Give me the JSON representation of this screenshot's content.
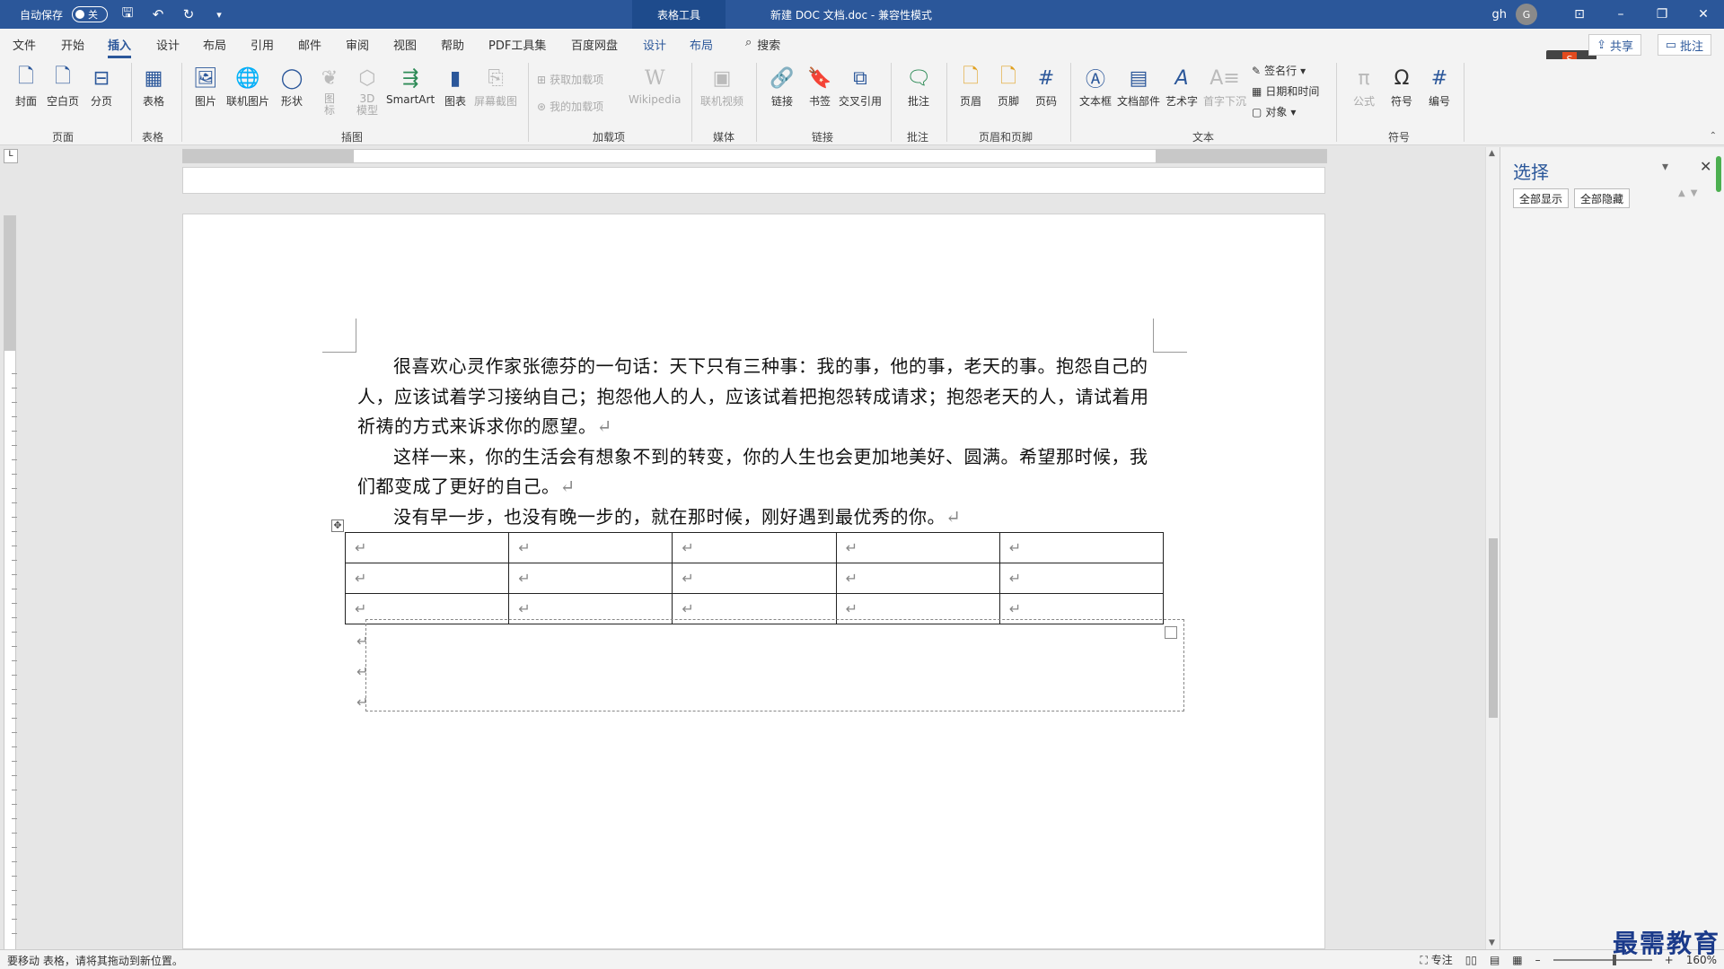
{
  "titlebar": {
    "autosave_label": "自动保存",
    "autosave_state": "关",
    "context_tab": "表格工具",
    "document_title": "新建 DOC 文档.doc  -  兼容性模式",
    "user": "gh",
    "avatar_initial": "G"
  },
  "tabs": {
    "file": "文件",
    "home": "开始",
    "insert": "插入",
    "design": "设计",
    "layout": "布局",
    "references": "引用",
    "mailings": "邮件",
    "review": "审阅",
    "view": "视图",
    "help": "帮助",
    "pdf": "PDF工具集",
    "baidu": "百度网盘",
    "table_design": "设计",
    "table_layout": "布局",
    "search": "搜索"
  },
  "header_actions": {
    "share": "共享",
    "comment": "批注"
  },
  "ribbon": {
    "cover": "封面",
    "blank_page": "空白页",
    "page_break": "分页",
    "table": "表格",
    "picture": "图片",
    "online_picture": "联机图片",
    "shapes": "形状",
    "icons": "图\n标",
    "model3d": "3D\n模型",
    "smartart": "SmartArt",
    "chart": "图表",
    "screenshot": "屏幕截图",
    "get_addins": "获取加载项",
    "my_addins": "我的加载项",
    "wikipedia": "Wikipedia",
    "online_video": "联机视频",
    "link": "链接",
    "bookmark": "书签",
    "cross_ref": "交叉引用",
    "comment": "批注",
    "header": "页眉",
    "footer": "页脚",
    "page_number": "页码",
    "textbox": "文本框",
    "quick_parts": "文档部件",
    "wordart": "艺术字",
    "dropcap": "首字下沉",
    "signature": "签名行",
    "datetime": "日期和时间",
    "object": "对象",
    "equation": "公式",
    "symbol": "符号",
    "number": "编号",
    "groups": {
      "pages": "页面",
      "tables": "表格",
      "illustrations": "插图",
      "addins": "加载项",
      "media": "媒体",
      "links": "链接",
      "comments": "批注",
      "header_footer": "页眉和页脚",
      "text": "文本",
      "symbols": "符号"
    }
  },
  "document": {
    "paragraphs": [
      "很喜欢心灵作家张德芬的一句话：天下只有三种事：我的事，他的事，老天的事。抱怨自己的人，应该试着学习接纳自己；抱怨他人的人，应该试着把抱怨转成请求；抱怨老天的人，请试着用祈祷的方式来诉求你的愿望。",
      "这样一来，你的生活会有想象不到的转变，你的人生也会更加地美好、圆满。希望那时候，我们都变成了更好的自己。",
      "没有早一步，也没有晚一步的，就在那时候，刚好遇到最优秀的你。"
    ],
    "paragraph_mark": "↵",
    "table_move_handle": "✥",
    "table": {
      "rows": 3,
      "cols": 5
    }
  },
  "pane": {
    "title": "选择",
    "show_all": "全部显示",
    "hide_all": "全部隐藏"
  },
  "status": {
    "message": "要移动 表格，请将其拖动到新位置。",
    "focus": "专注",
    "zoom": "160%"
  },
  "watermark": "最需教育"
}
